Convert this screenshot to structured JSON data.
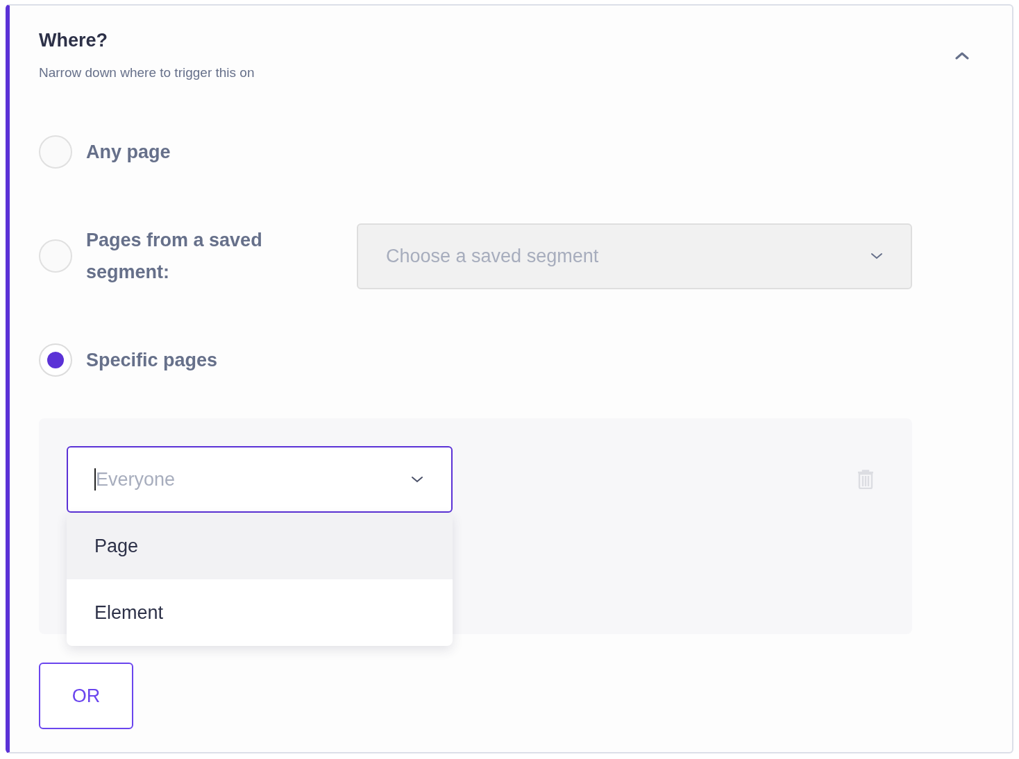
{
  "section": {
    "title": "Where?",
    "subtitle": "Narrow down where to trigger this on",
    "expanded": true
  },
  "options": [
    {
      "kind": "plain",
      "label": "Any page",
      "selected": false
    },
    {
      "kind": "segment",
      "label": "Pages from a saved segment:",
      "selected": false,
      "select": {
        "placeholder": "Choose a saved segment",
        "disabled": true
      }
    },
    {
      "kind": "plain",
      "label": "Specific pages",
      "selected": true
    }
  ],
  "rule": {
    "select": {
      "placeholder": "Everyone",
      "open": true
    },
    "menu": [
      {
        "label": "Page",
        "highlighted": true
      },
      {
        "label": "Element",
        "highlighted": false
      }
    ]
  },
  "or_button": "OR"
}
